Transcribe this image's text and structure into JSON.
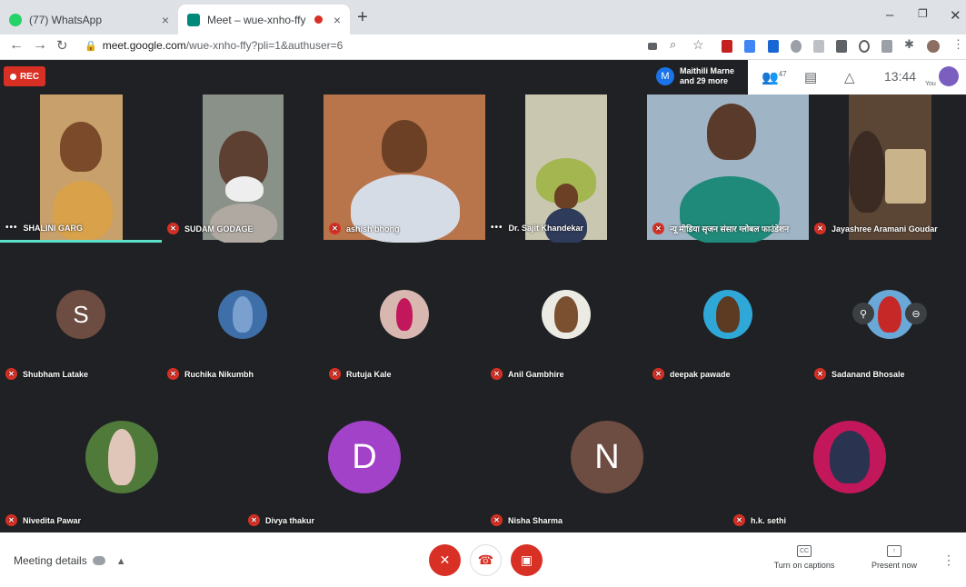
{
  "browser": {
    "tabs": [
      {
        "title": "(77) WhatsApp",
        "close": "×"
      },
      {
        "title": "Meet – wue-xnho-ffy",
        "close": "×"
      }
    ],
    "new_tab": "+",
    "window_controls": [
      "–",
      "❐",
      "✕"
    ],
    "url_host": "meet.google.com",
    "url_path": "/wue-xnho-ffy?pli=1&authuser=6"
  },
  "meet_header": {
    "rec_label": "REC",
    "presenter_initial": "M",
    "presenter_line1": "Maithili Marne",
    "presenter_line2": "and 29 more",
    "participant_count": "47",
    "clock": "13:44",
    "you_label": "You"
  },
  "participants": [
    {
      "name": "SHALINI GARG",
      "status": "speaking"
    },
    {
      "name": "SUDAM GODAGE",
      "status": "muted"
    },
    {
      "name": "ashish bhong",
      "status": "muted"
    },
    {
      "name": "Dr. Sajit Khandekar",
      "status": "speaking"
    },
    {
      "name": "न्यू मीडिया सृजन संसार ग्लोबल फाउंडेशन",
      "status": "muted"
    },
    {
      "name": "Jayashree Aramani Goudar",
      "status": "muted"
    },
    {
      "name": "Shubham Latake",
      "initial": "S",
      "color": "#6d4c41"
    },
    {
      "name": "Ruchika Nikumbh"
    },
    {
      "name": "Rutuja Kale"
    },
    {
      "name": "Anil Gambhire"
    },
    {
      "name": "deepak pawade"
    },
    {
      "name": "Sadanand Bhosale"
    },
    {
      "name": "Nivedita Pawar"
    },
    {
      "name": "Divya thakur",
      "initial": "D",
      "color": "#a142c8"
    },
    {
      "name": "Nisha Sharma",
      "initial": "N",
      "color": "#6d4c41"
    },
    {
      "name": "h.k. sethi"
    }
  ],
  "bottom": {
    "meeting_details": "Meeting details",
    "captions": "Turn on captions",
    "present": "Present now"
  },
  "colors": {
    "red": "#d93025",
    "bg": "#202124",
    "speaking": "#5ce0c8"
  }
}
